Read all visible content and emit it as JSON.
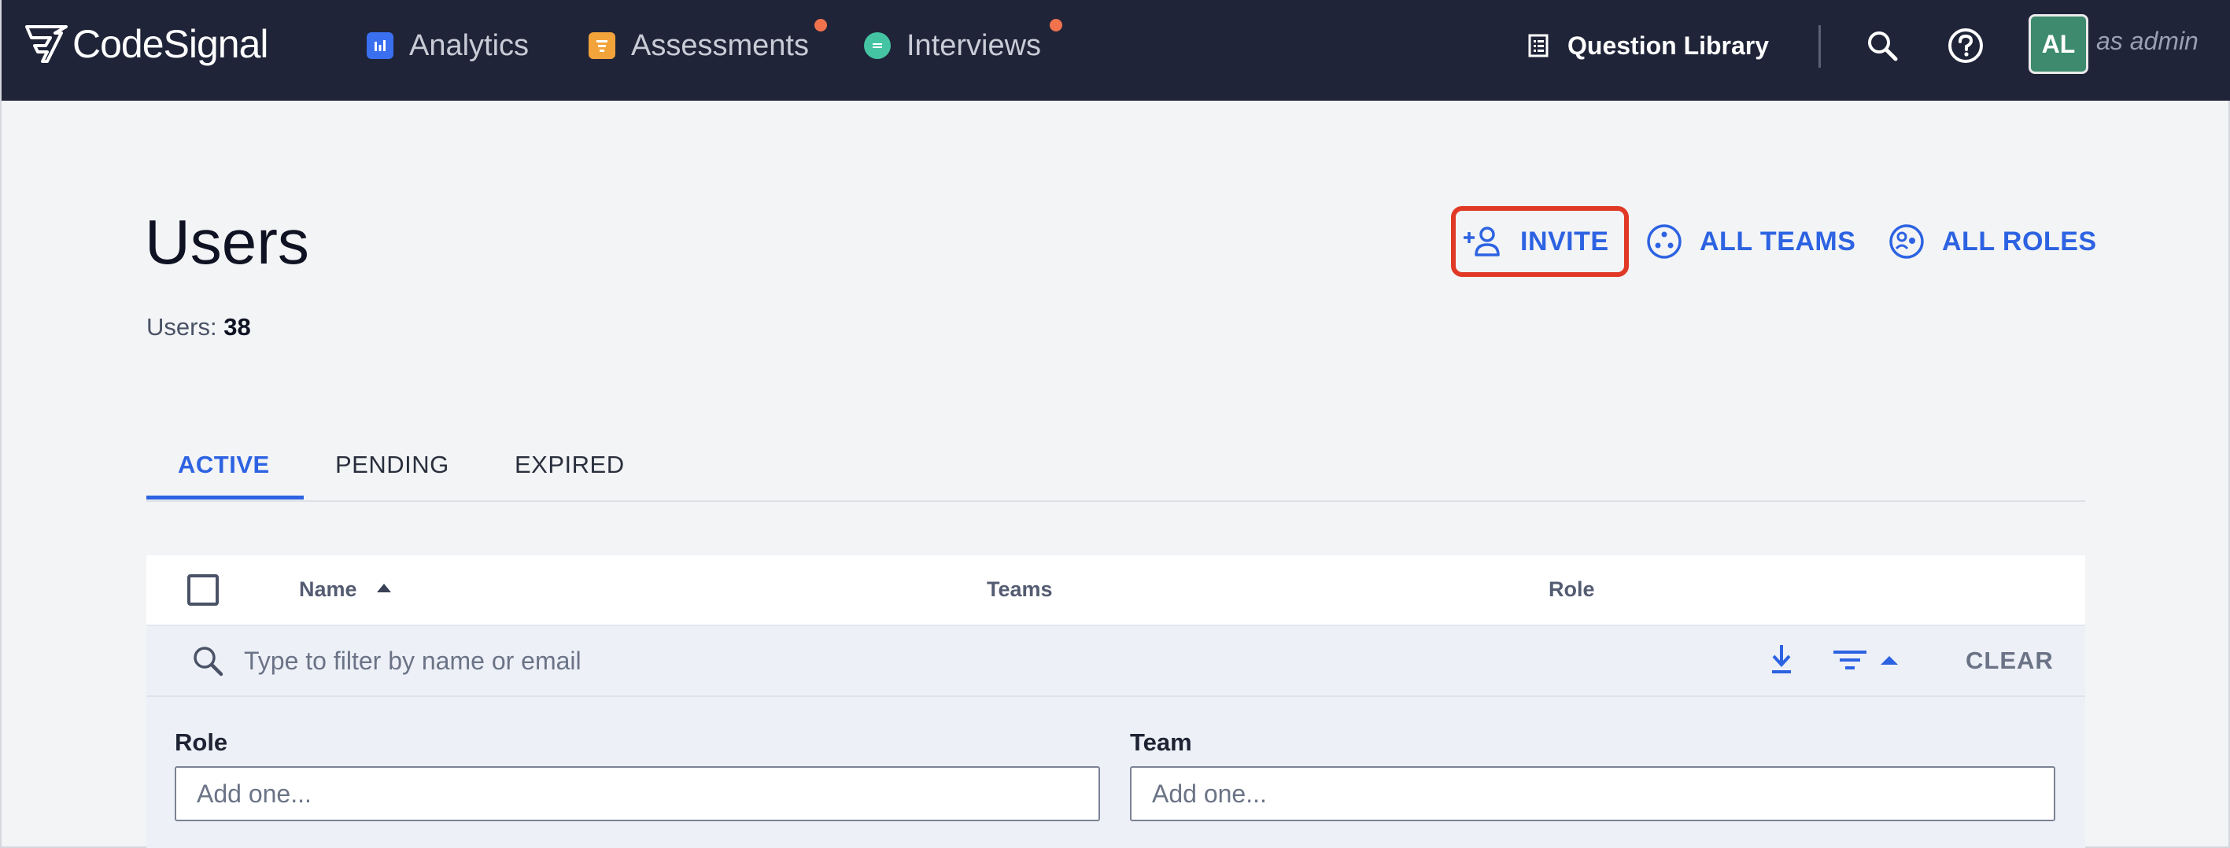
{
  "nav": {
    "logo_text": "CodeSignal",
    "items": [
      {
        "label": "Analytics",
        "icon": "bar-chart-icon",
        "color": "#3a6ff0"
      },
      {
        "label": "Assessments",
        "icon": "assessment-icon",
        "color": "#f2a33a"
      },
      {
        "label": "Interviews",
        "icon": "chat-icon",
        "color": "#45c4a3"
      }
    ],
    "question_library": "Question Library",
    "avatar_initials": "AL",
    "as_admin": "as admin"
  },
  "header": {
    "title": "Users",
    "count_label": "Users:",
    "count": "38",
    "actions": {
      "invite": "INVITE",
      "all_teams": "ALL TEAMS",
      "all_roles": "ALL ROLES"
    }
  },
  "tabs": [
    "ACTIVE",
    "PENDING",
    "EXPIRED"
  ],
  "table": {
    "columns": {
      "name": "Name",
      "teams": "Teams",
      "role": "Role"
    },
    "filter_placeholder": "Type to filter by name or email",
    "clear": "CLEAR",
    "role_label": "Role",
    "team_label": "Team",
    "add_placeholder": "Add one..."
  },
  "colors": {
    "accent": "#2d63e2",
    "nav_bg": "#1f2438",
    "highlight": "#e03a26",
    "avatar": "#3d8a6e"
  }
}
